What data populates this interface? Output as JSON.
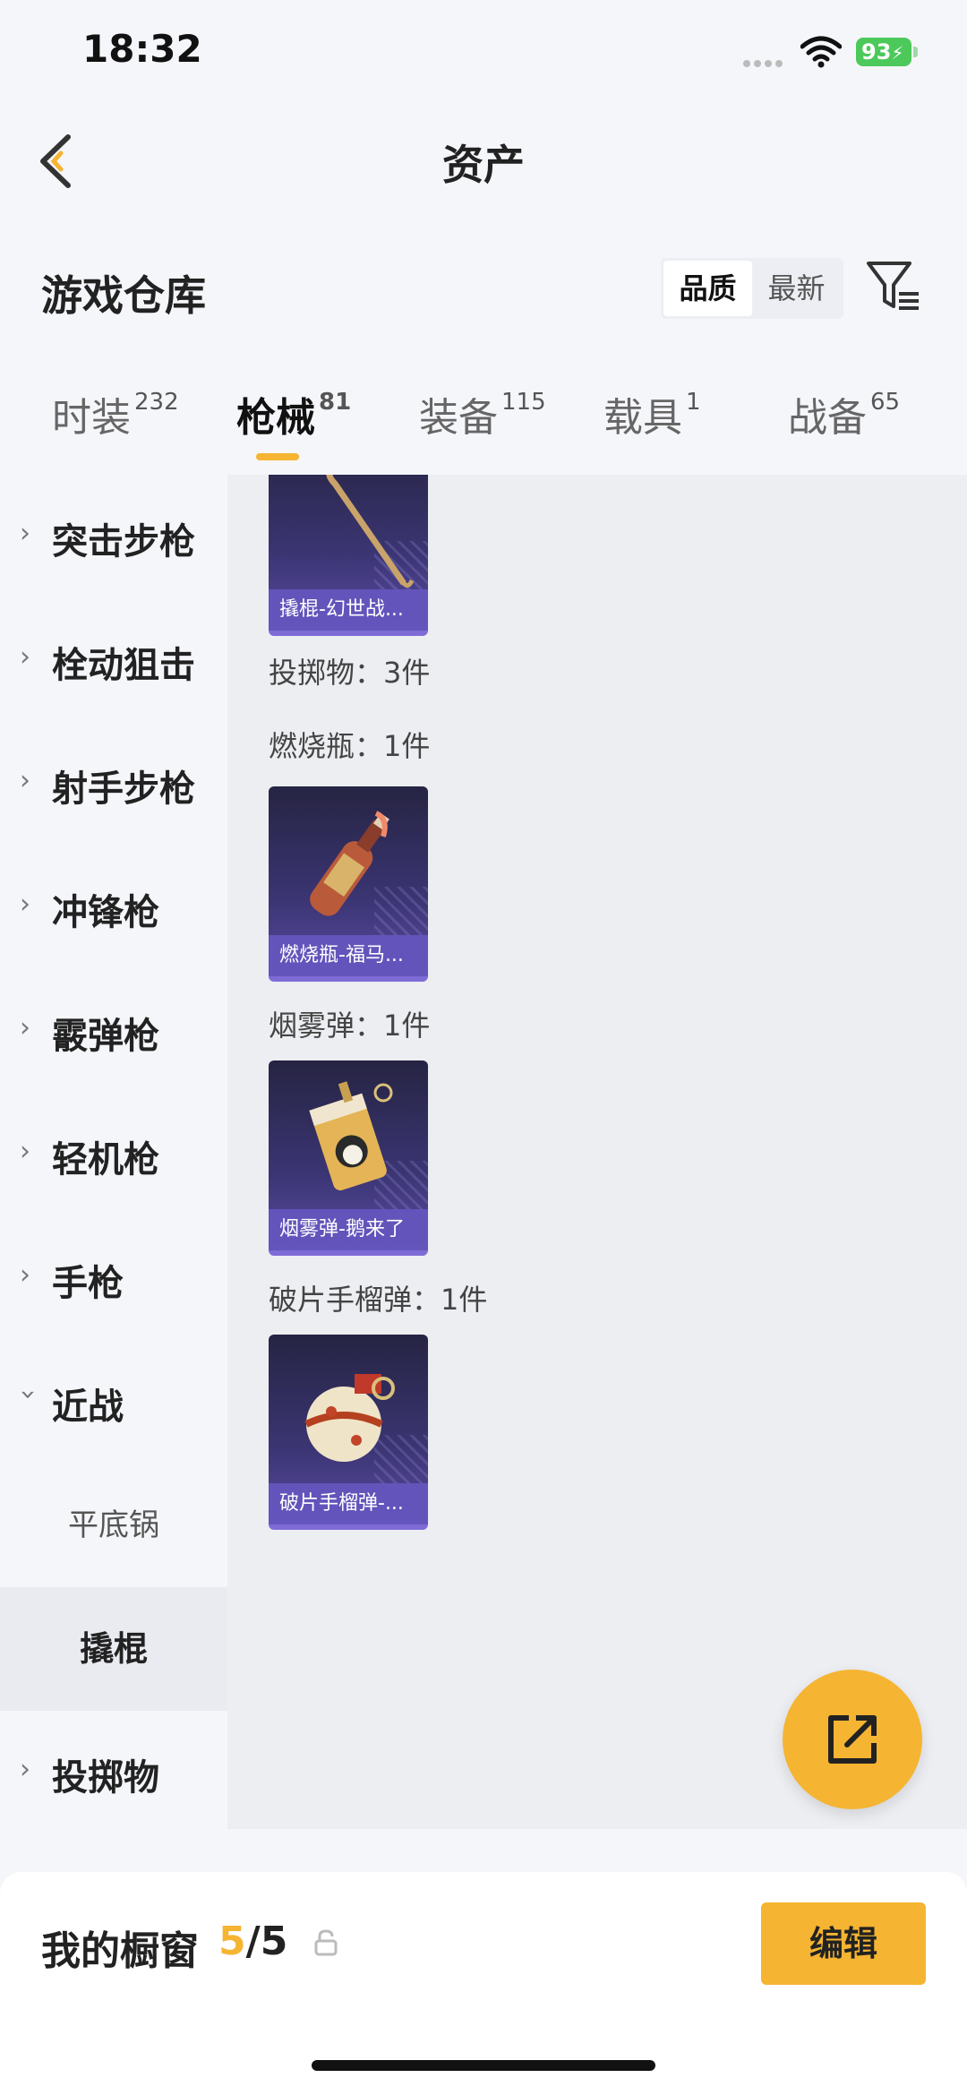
{
  "status_bar": {
    "time": "18:32",
    "battery": "93"
  },
  "header": {
    "title": "资产"
  },
  "section": {
    "title": "游戏仓库",
    "sort_options": [
      "品质",
      "最新"
    ],
    "active_sort": "品质"
  },
  "tabs": [
    {
      "label": "时装",
      "count": "232"
    },
    {
      "label": "枪械",
      "count": "81"
    },
    {
      "label": "装备",
      "count": "115"
    },
    {
      "label": "载具",
      "count": "1"
    },
    {
      "label": "战备",
      "count": "65"
    }
  ],
  "active_tab": "枪械",
  "sidebar": {
    "items": [
      {
        "label": "突击步枪"
      },
      {
        "label": "栓动狙击"
      },
      {
        "label": "射手步枪"
      },
      {
        "label": "冲锋枪"
      },
      {
        "label": "霰弹枪"
      },
      {
        "label": "轻机枪"
      },
      {
        "label": "手枪"
      },
      {
        "label": "近战"
      }
    ],
    "sub_items": [
      {
        "label": "平底锅"
      },
      {
        "label": "撬棍"
      }
    ],
    "last_item": {
      "label": "投掷物"
    }
  },
  "content": {
    "top_card": {
      "caption": "撬棍-幻世战..."
    },
    "group_title": "投掷物：3件",
    "groups": [
      {
        "title": "燃烧瓶：1件",
        "caption": "燃烧瓶-福马..."
      },
      {
        "title": "烟雾弹：1件",
        "caption": "烟雾弹-鹅来了"
      },
      {
        "title": "破片手榴弹：1件",
        "caption": "破片手榴弹-..."
      }
    ]
  },
  "bottom": {
    "label": "我的橱窗",
    "current": "5",
    "total": "/5",
    "edit_label": "编辑"
  },
  "colors": {
    "accent": "#f5b431",
    "card_purple": "#3b3573"
  }
}
